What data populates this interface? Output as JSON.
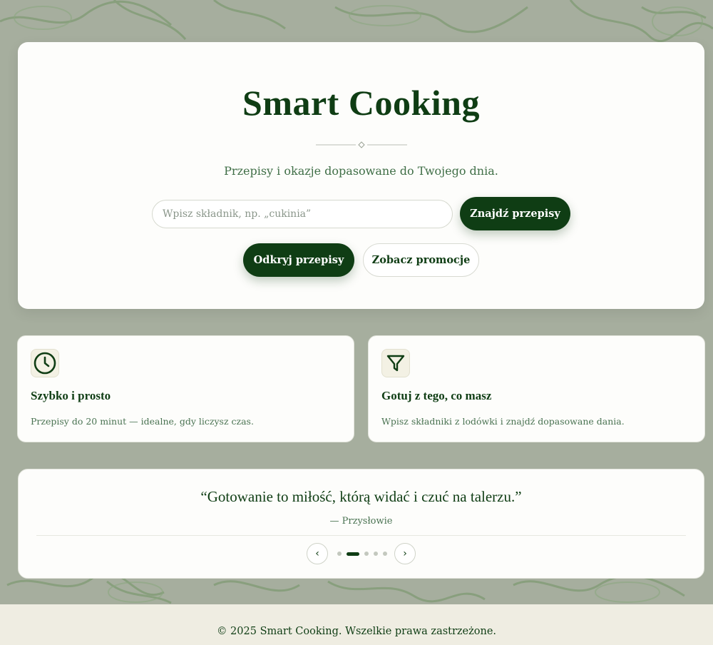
{
  "brand": {
    "title": "Smart Cooking",
    "tagline": "Przepisy i okazje dopasowane do Twojego dnia."
  },
  "search": {
    "placeholder": "Wpisz składnik, np. „cukinia”",
    "button_label": "Znajdź przepisy"
  },
  "actions": {
    "discover_label": "Odkryj przepisy",
    "promotions_label": "Zobacz promocje"
  },
  "features": [
    {
      "icon": "clock-icon",
      "title": "Szybko i prosto",
      "description": "Przepisy do 20 minut — idealne, gdy liczysz czas."
    },
    {
      "icon": "filter-icon",
      "title": "Gotuj z tego, co masz",
      "description": "Wpisz składniki z lodówki i znajdź dopasowane dania."
    }
  ],
  "quote": {
    "text": "“Gotowanie to miłość, którą widać i czuć na talerzu.”",
    "author": "— Przysłowie",
    "prev_symbol": "‹",
    "next_symbol": "›",
    "slide_count": 5,
    "active_slide": 2
  },
  "footer": {
    "copyright": "© 2025 Smart Cooking. Wszelkie prawa zastrzeżone."
  },
  "colors": {
    "accent": "#0f3d14",
    "background": "#a6ae9e",
    "card": "#fdfdfb",
    "footer": "#efede2"
  }
}
